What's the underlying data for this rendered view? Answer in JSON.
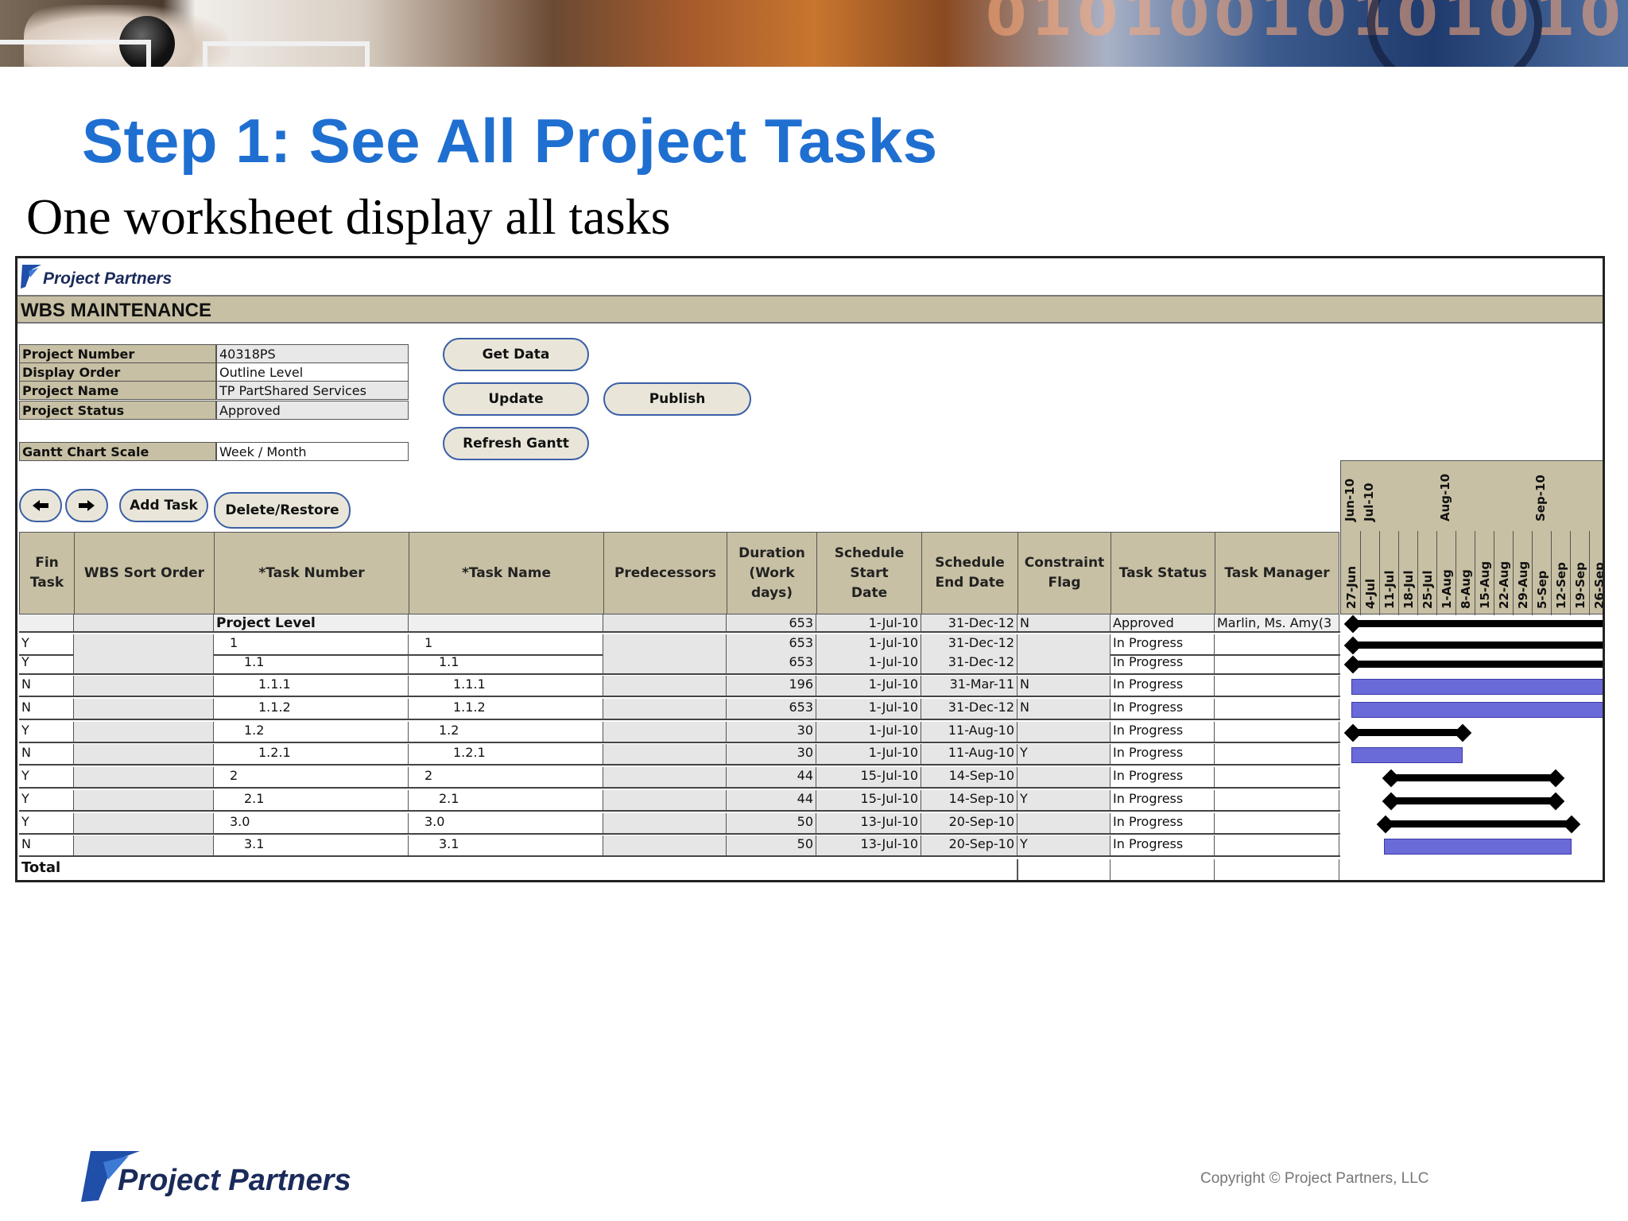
{
  "slide": {
    "title": "Step 1: See All Project Tasks",
    "subtitle": "One worksheet display all tasks",
    "copyright": "Copyright © Project Partners, LLC",
    "logo_text": "Project Partners"
  },
  "sheet": {
    "logo_text": "Project Partners",
    "section_title": "WBS MAINTENANCE",
    "info": [
      {
        "label": "Project Number",
        "value": "40318PS"
      },
      {
        "label": "Display Order",
        "value": "Outline Level"
      },
      {
        "label": "Project Name",
        "value": "TP PartShared Services"
      },
      {
        "label": "Project Status",
        "value": "Approved"
      }
    ],
    "scale": {
      "label": "Gantt Chart Scale",
      "value": "Week / Month"
    },
    "buttons": {
      "get_data": "Get Data",
      "update": "Update",
      "publish": "Publish",
      "refresh_gantt": "Refresh Gantt",
      "add_task": "Add Task",
      "delete_restore": "Delete/Restore",
      "prev_icon": "arrow-left-icon",
      "next_icon": "arrow-right-icon"
    },
    "columns": [
      "Fin Task",
      "WBS Sort Order",
      "*Task Number",
      "*Task Name",
      "Predecessors",
      "Duration (Work days)",
      "Schedule Start Date",
      "Schedule End Date",
      "Constraint Flag",
      "Task Status",
      "Task Manager"
    ],
    "rows": [
      {
        "fin": "",
        "sort": "",
        "num": "Project Level",
        "name": "",
        "pred": "",
        "dur": "653",
        "start": "1-Jul-10",
        "end": "31-Dec-12",
        "flag": "N",
        "status": "Approved",
        "mgr": "Marlin, Ms. Amy(3"
      },
      {
        "fin": "Y",
        "sort": "",
        "num": "1",
        "name": "1",
        "pred": "",
        "dur": "653",
        "start": "1-Jul-10",
        "end": "31-Dec-12",
        "flag": "",
        "status": "In Progress",
        "mgr": ""
      },
      {
        "fin": "Y",
        "sort": "",
        "num": "1.1",
        "name": "1.1",
        "pred": "",
        "dur": "653",
        "start": "1-Jul-10",
        "end": "31-Dec-12",
        "flag": "",
        "status": "In Progress",
        "mgr": ""
      },
      {
        "fin": "N",
        "sort": "",
        "num": "1.1.1",
        "name": "1.1.1",
        "pred": "",
        "dur": "196",
        "start": "1-Jul-10",
        "end": "31-Mar-11",
        "flag": "N",
        "status": "In Progress",
        "mgr": ""
      },
      {
        "fin": "N",
        "sort": "",
        "num": "1.1.2",
        "name": "1.1.2",
        "pred": "",
        "dur": "653",
        "start": "1-Jul-10",
        "end": "31-Dec-12",
        "flag": "N",
        "status": "In Progress",
        "mgr": ""
      },
      {
        "fin": "Y",
        "sort": "",
        "num": "1.2",
        "name": "1.2",
        "pred": "",
        "dur": "30",
        "start": "1-Jul-10",
        "end": "11-Aug-10",
        "flag": "",
        "status": "In Progress",
        "mgr": ""
      },
      {
        "fin": "N",
        "sort": "",
        "num": "1.2.1",
        "name": "1.2.1",
        "pred": "",
        "dur": "30",
        "start": "1-Jul-10",
        "end": "11-Aug-10",
        "flag": "Y",
        "status": "In Progress",
        "mgr": ""
      },
      {
        "fin": "Y",
        "sort": "",
        "num": "2",
        "name": "2",
        "pred": "",
        "dur": "44",
        "start": "15-Jul-10",
        "end": "14-Sep-10",
        "flag": "",
        "status": "In Progress",
        "mgr": ""
      },
      {
        "fin": "Y",
        "sort": "",
        "num": "2.1",
        "name": "2.1",
        "pred": "",
        "dur": "44",
        "start": "15-Jul-10",
        "end": "14-Sep-10",
        "flag": "Y",
        "status": "In Progress",
        "mgr": ""
      },
      {
        "fin": "Y",
        "sort": "",
        "num": "3.0",
        "name": "3.0",
        "pred": "",
        "dur": "50",
        "start": "13-Jul-10",
        "end": "20-Sep-10",
        "flag": "",
        "status": "In Progress",
        "mgr": ""
      },
      {
        "fin": "N",
        "sort": "",
        "num": "3.1",
        "name": "3.1",
        "pred": "",
        "dur": "50",
        "start": "13-Jul-10",
        "end": "20-Sep-10",
        "flag": "Y",
        "status": "In Progress",
        "mgr": ""
      }
    ],
    "total_label": "Total",
    "gantt": {
      "months": [
        "Jun-10",
        "Jul-10",
        "Aug-10",
        "Sep-10"
      ],
      "weeks": [
        "27-Jun",
        "4-Jul",
        "11-Jul",
        "18-Jul",
        "25-Jul",
        "1-Aug",
        "8-Aug",
        "15-Aug",
        "22-Aug",
        "29-Aug",
        "5-Sep",
        "12-Sep",
        "19-Sep",
        "26-Sep"
      ],
      "summary_color": "#000000",
      "task_color": "#6a6ad8"
    }
  }
}
